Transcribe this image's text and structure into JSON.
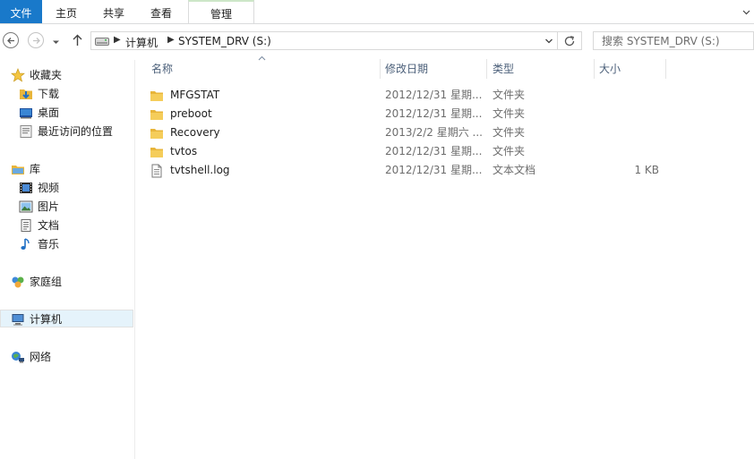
{
  "ribbon": {
    "tabs": [
      "文件",
      "主页",
      "共享",
      "查看",
      "管理"
    ]
  },
  "address": {
    "segments": [
      "计算机",
      "SYSTEM_DRV (S:)"
    ]
  },
  "search": {
    "placeholder": "搜索 SYSTEM_DRV (S:)"
  },
  "sidebar": {
    "favorites": {
      "label": "收藏夹",
      "items": [
        "下载",
        "桌面",
        "最近访问的位置"
      ]
    },
    "libraries": {
      "label": "库",
      "items": [
        "视频",
        "图片",
        "文档",
        "音乐"
      ]
    },
    "homegroup": "家庭组",
    "computer": "计算机",
    "network": "网络"
  },
  "columns": {
    "name": "名称",
    "date": "修改日期",
    "type": "类型",
    "size": "大小"
  },
  "files": [
    {
      "name": "MFGSTAT",
      "date": "2012/12/31 星期...",
      "type": "文件夹",
      "size": "",
      "icon": "folder-icon"
    },
    {
      "name": "preboot",
      "date": "2012/12/31 星期...",
      "type": "文件夹",
      "size": "",
      "icon": "folder-icon"
    },
    {
      "name": "Recovery",
      "date": "2013/2/2 星期六 ...",
      "type": "文件夹",
      "size": "",
      "icon": "folder-icon"
    },
    {
      "name": "tvtos",
      "date": "2012/12/31 星期...",
      "type": "文件夹",
      "size": "",
      "icon": "folder-icon"
    },
    {
      "name": "tvtshell.log",
      "date": "2012/12/31 星期...",
      "type": "文本文档",
      "size": "1 KB",
      "icon": "text-file-icon"
    }
  ],
  "colors": {
    "accent": "#1979ca",
    "selection": "#e5f3fb",
    "folder": "#e8b53a"
  }
}
